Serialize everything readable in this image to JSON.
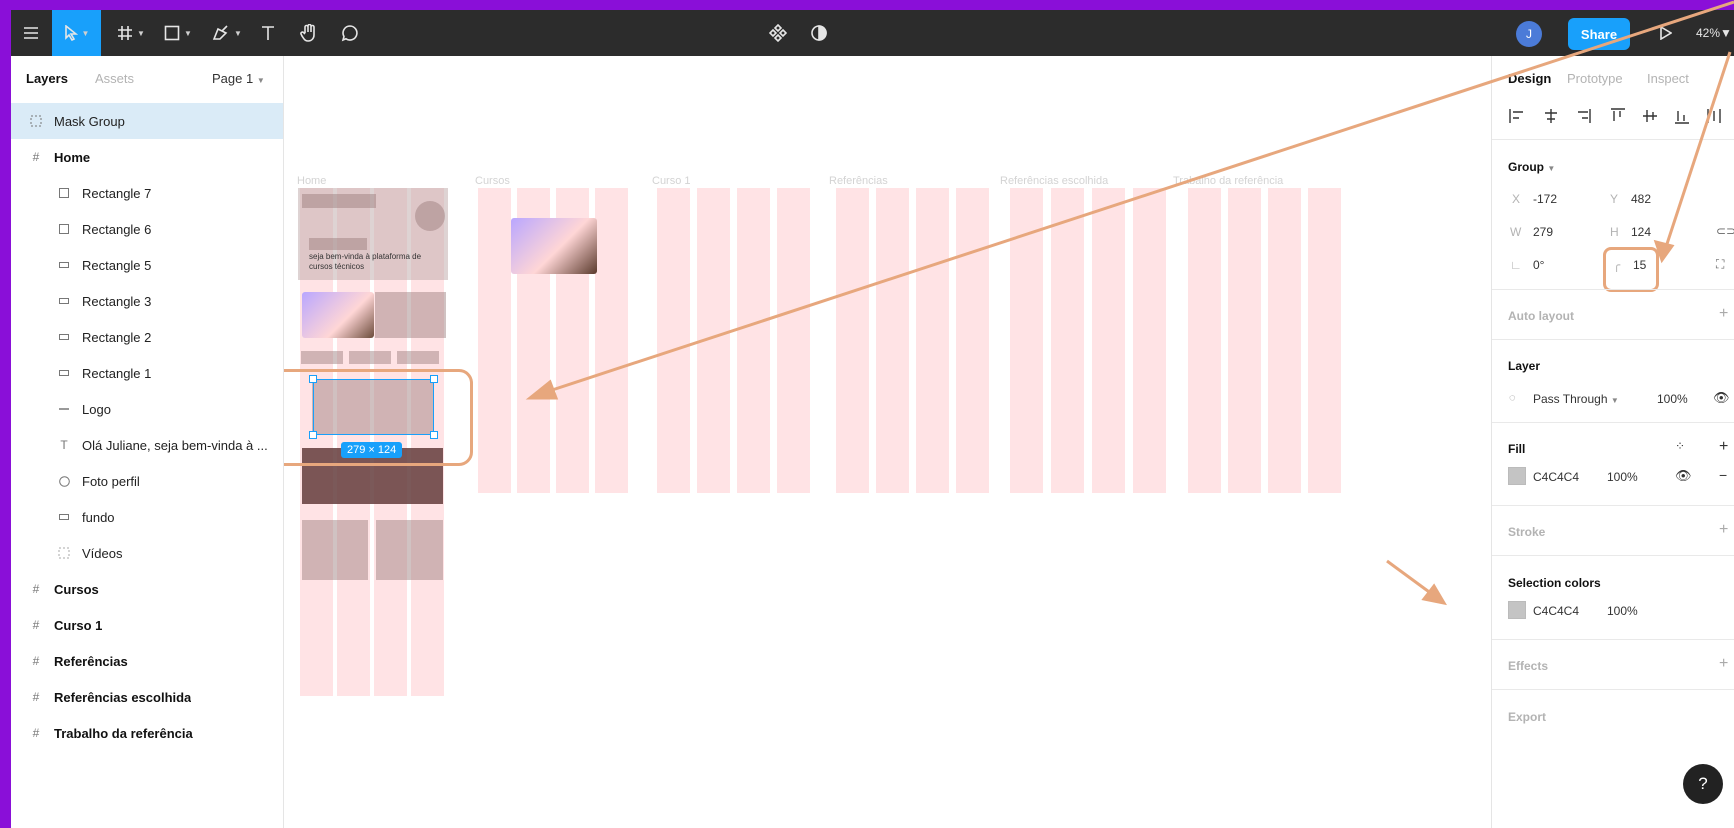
{
  "colors": {
    "accent": "#18a0fb",
    "annotation": "#e7a77d",
    "background": "#8a0fd8",
    "fill": "#c4c4c4"
  },
  "toolbar": {
    "tools": [
      {
        "name": "menu-icon"
      },
      {
        "name": "move-tool-icon"
      },
      {
        "name": "frame-tool-icon"
      },
      {
        "name": "shape-tool-icon"
      },
      {
        "name": "pen-tool-icon"
      },
      {
        "name": "text-tool-icon"
      },
      {
        "name": "hand-tool-icon"
      },
      {
        "name": "comment-tool-icon"
      }
    ],
    "avatar_initial": "J",
    "share_label": "Share",
    "zoom": "42%"
  },
  "left_panel": {
    "tab_layers": "Layers",
    "tab_assets": "Assets",
    "page": "Page 1",
    "layers": [
      {
        "label": "Mask Group",
        "icon": "mask-group-icon"
      },
      {
        "label": "Home",
        "icon": "frame-icon"
      },
      {
        "label": "Rectangle 7",
        "icon": "rectangle-icon"
      },
      {
        "label": "Rectangle 6",
        "icon": "rectangle-icon"
      },
      {
        "label": "Rectangle 5",
        "icon": "rectangle-icon"
      },
      {
        "label": "Rectangle 3",
        "icon": "rectangle-icon"
      },
      {
        "label": "Rectangle 2",
        "icon": "rectangle-icon"
      },
      {
        "label": "Rectangle 1",
        "icon": "rectangle-icon"
      },
      {
        "label": "Logo",
        "icon": "line-icon"
      },
      {
        "label": "Olá Juliane, seja bem-vinda à ...",
        "icon": "text-icon"
      },
      {
        "label": "Foto perfil",
        "icon": "ellipse-icon"
      },
      {
        "label": "fundo",
        "icon": "rectangle-icon"
      },
      {
        "label": "Vídeos",
        "icon": "group-icon"
      },
      {
        "label": "Cursos",
        "icon": "frame-icon"
      },
      {
        "label": "Curso 1",
        "icon": "frame-icon"
      },
      {
        "label": "Referências",
        "icon": "frame-icon"
      },
      {
        "label": "Referências escolhida",
        "icon": "frame-icon"
      },
      {
        "label": "Trabalho da referência",
        "icon": "frame-icon"
      }
    ]
  },
  "canvas": {
    "frames": [
      "Home",
      "Cursos",
      "Curso 1",
      "Referências",
      "Referências escolhida",
      "Trabalho da referência"
    ],
    "home_text": "seja bem-vinda à plataforma de cursos técnicos",
    "selection_size": "279 × 124"
  },
  "right_panel": {
    "tabs": [
      "Design",
      "Prototype",
      "Inspect"
    ],
    "group_label": "Group",
    "x_label": "X",
    "x": "-172",
    "y_label": "Y",
    "y": "482",
    "w_label": "W",
    "w": "279",
    "h_label": "H",
    "h": "124",
    "rotation": "0°",
    "radius": "15",
    "auto_layout": "Auto layout",
    "layer_title": "Layer",
    "blend": "Pass Through",
    "layer_opacity": "100%",
    "fill_title": "Fill",
    "fill_hex": "C4C4C4",
    "fill_opacity": "100%",
    "stroke_title": "Stroke",
    "selection_colors_title": "Selection colors",
    "sel_hex": "C4C4C4",
    "sel_opacity": "100%",
    "effects_title": "Effects",
    "export_title": "Export"
  },
  "help_label": "?"
}
